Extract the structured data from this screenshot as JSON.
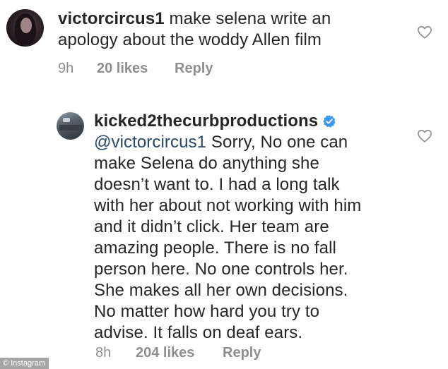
{
  "comments": [
    {
      "username": "victorcircus1",
      "text": " make selena write an apology about the woddy Allen film",
      "line2": "apology about the woddy Allen film",
      "line1_rest": " make selena write an",
      "time": "9h",
      "likes": "20 likes",
      "reply": "Reply"
    },
    {
      "username": "kicked2thecurbproductions",
      "verified": true,
      "mention": "@victorcircus1",
      "lines": [
        " Sorry, No one can",
        "make Selena do anything she",
        "doesn’t want to. I had a long talk",
        "with her about not working with him",
        "and it didn’t click. Her team are",
        "amazing people. There is no fall",
        "person here. No one controls her.",
        "She makes all her own decisions.",
        "No matter how hard you try to",
        "advise. It falls on deaf ears."
      ],
      "time": "8h",
      "likes": "204 likes",
      "reply": "Reply"
    }
  ],
  "watermark": {
    "symbol": "©",
    "label": "Instagram"
  },
  "colors": {
    "text": "#262626",
    "meta": "#8e8e8e",
    "verified": "#3897f0",
    "mention": "#27466b"
  },
  "icons": {
    "like": "heart-outline-icon",
    "verified": "verified-badge-icon"
  }
}
